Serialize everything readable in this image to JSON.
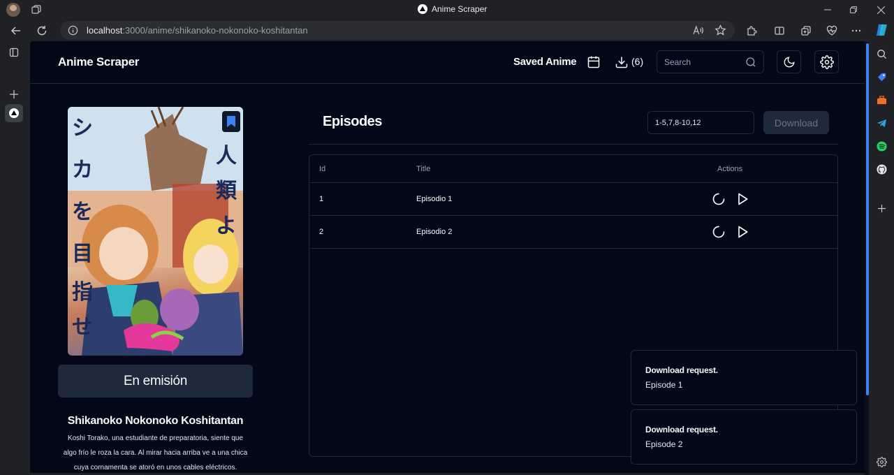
{
  "browser": {
    "window_title": "Anime Scraper",
    "url_host": "localhost",
    "url_path": ":3000/anime/shikanoko-nokonoko-koshitantan"
  },
  "header": {
    "brand": "Anime Scraper",
    "saved_anime_label": "Saved Anime",
    "downloads_count": "(6)",
    "search_placeholder": "Search"
  },
  "anime": {
    "status": "En emisión",
    "title": "Shikanoko Nokonoko Koshitantan",
    "synopsis": "Koshi Torako, una estudiante de preparatoria, siente que algo frío le roza la cara. Al mirar hacia arriba ve a una chica cuya cornamenta se atoró en unos cables eléctricos."
  },
  "episodes": {
    "heading": "Episodes",
    "range_value": "1-5,7,8-10,12",
    "download_label": "Download",
    "columns": [
      "Id",
      "Title",
      "Actions"
    ],
    "rows": [
      {
        "id": "1",
        "title": "Episodio 1"
      },
      {
        "id": "2",
        "title": "Episodio 2"
      }
    ]
  },
  "toasts": [
    {
      "title": "Download request.",
      "description": "Episode 1"
    },
    {
      "title": "Download request.",
      "description": "Episode 2"
    }
  ],
  "colors": {
    "page_bg": "#020817",
    "border": "#1e293b",
    "accent": "#3b82f6"
  }
}
